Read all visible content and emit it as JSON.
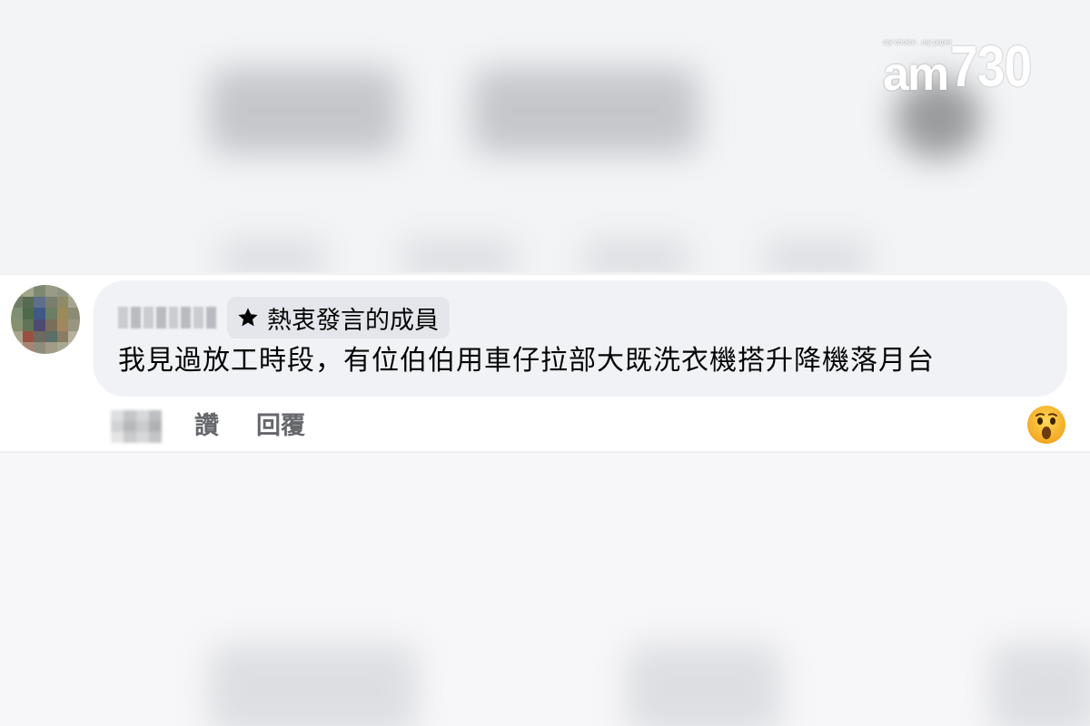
{
  "logo": {
    "tagline": "my choice . my paper",
    "brand_letters": "am",
    "brand_number": "730"
  },
  "comment": {
    "badge_icon": "star-icon",
    "badge_label": "熱衷發言的成員",
    "text": "我見過放工時段，有位伯伯用車仔拉部大既洗衣機搭升降機落月台"
  },
  "actions": {
    "like_label": "讚",
    "reply_label": "回覆"
  },
  "reaction": {
    "icon": "wow-reaction-icon",
    "colors": {
      "face": "#f7b125",
      "mouth": "#6b3a0e"
    }
  },
  "colors": {
    "bubble": "#f0f2f5",
    "badge": "#e4e6eb",
    "secondary_text": "#65676b",
    "primary_text": "#050505"
  }
}
